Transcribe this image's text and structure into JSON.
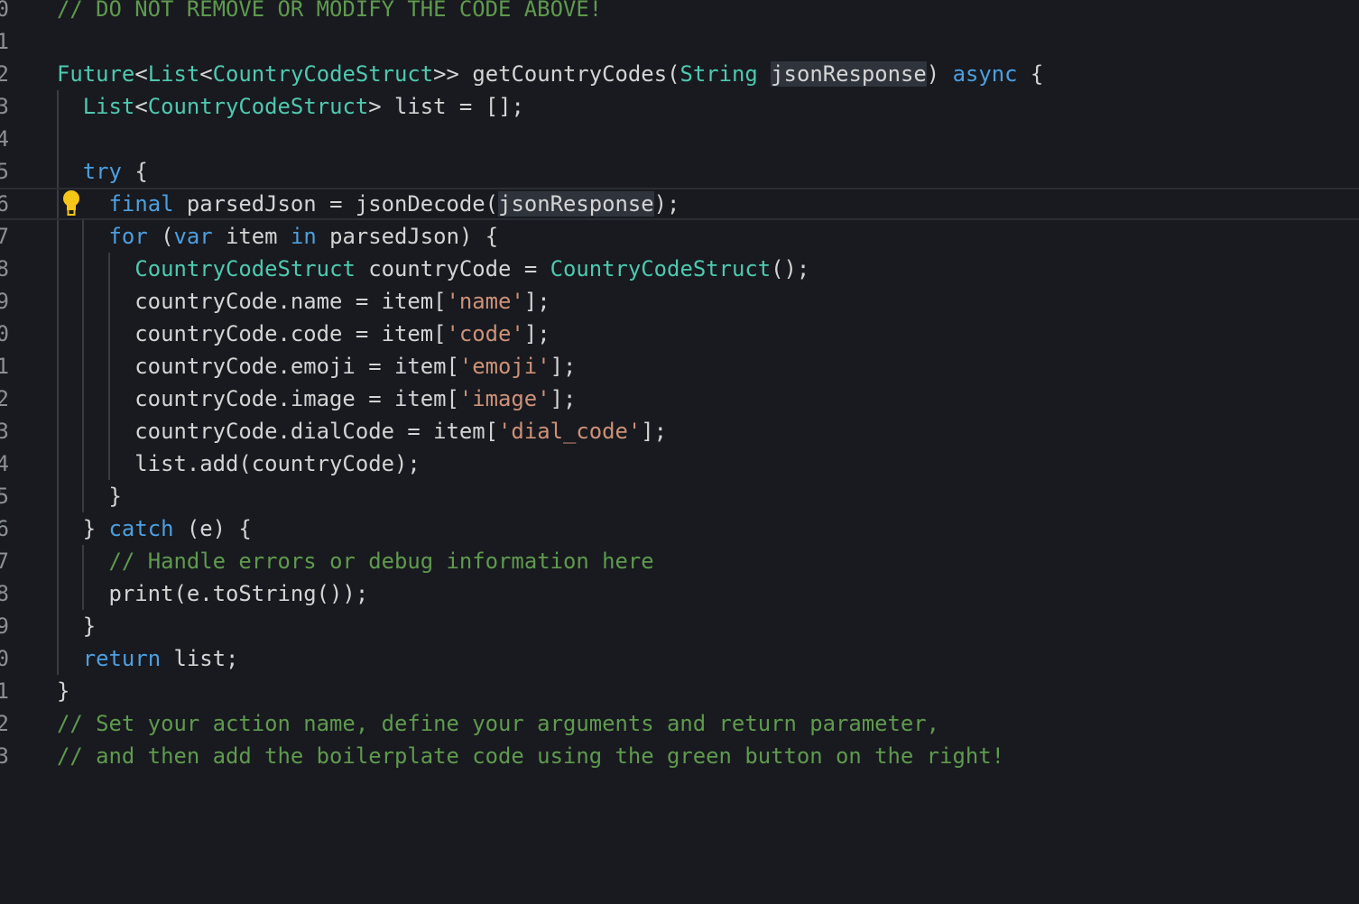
{
  "editor": {
    "current_line_index": 6,
    "colors": {
      "background": "#181a1f",
      "comment": "#5f9a4e",
      "type": "#4ec9b0",
      "keyword": "#4d9fe0",
      "string": "#ce9178",
      "text": "#d4d4d4"
    },
    "lightbulb_icon": "lightbulb-icon",
    "lines": [
      {
        "num": "0",
        "tokens": [
          {
            "t": "comment",
            "v": "// DO NOT REMOVE OR MODIFY THE CODE ABOVE!"
          }
        ]
      },
      {
        "num": "1",
        "tokens": []
      },
      {
        "num": "2",
        "tokens": [
          {
            "t": "type",
            "v": "Future"
          },
          {
            "t": "plain",
            "v": "<"
          },
          {
            "t": "type",
            "v": "List"
          },
          {
            "t": "plain",
            "v": "<"
          },
          {
            "t": "type",
            "v": "CountryCodeStruct"
          },
          {
            "t": "plain",
            "v": ">> getCountryCodes("
          },
          {
            "t": "type",
            "v": "String"
          },
          {
            "t": "plain",
            "v": " "
          },
          {
            "t": "highlight",
            "v": "jsonResponse"
          },
          {
            "t": "plain",
            "v": ") "
          },
          {
            "t": "keyword",
            "v": "async"
          },
          {
            "t": "plain",
            "v": " {"
          }
        ]
      },
      {
        "num": "3",
        "tokens": [
          {
            "t": "plain",
            "v": "  "
          },
          {
            "t": "type",
            "v": "List"
          },
          {
            "t": "plain",
            "v": "<"
          },
          {
            "t": "type",
            "v": "CountryCodeStruct"
          },
          {
            "t": "plain",
            "v": "> list = [];"
          }
        ]
      },
      {
        "num": "4",
        "tokens": []
      },
      {
        "num": "5",
        "tokens": [
          {
            "t": "plain",
            "v": "  "
          },
          {
            "t": "keyword",
            "v": "try"
          },
          {
            "t": "plain",
            "v": " {"
          }
        ]
      },
      {
        "num": "6",
        "tokens": [
          {
            "t": "plain",
            "v": "    "
          },
          {
            "t": "keyword",
            "v": "final"
          },
          {
            "t": "plain",
            "v": " parsedJson = jsonDecode("
          },
          {
            "t": "highlight",
            "v": "jsonResponse"
          },
          {
            "t": "plain",
            "v": ");"
          }
        ]
      },
      {
        "num": "7",
        "tokens": [
          {
            "t": "plain",
            "v": "    "
          },
          {
            "t": "keyword",
            "v": "for"
          },
          {
            "t": "plain",
            "v": " ("
          },
          {
            "t": "keyword",
            "v": "var"
          },
          {
            "t": "plain",
            "v": " item "
          },
          {
            "t": "keyword",
            "v": "in"
          },
          {
            "t": "plain",
            "v": " parsedJson) {"
          }
        ]
      },
      {
        "num": "8",
        "tokens": [
          {
            "t": "plain",
            "v": "      "
          },
          {
            "t": "type",
            "v": "CountryCodeStruct"
          },
          {
            "t": "plain",
            "v": " countryCode = "
          },
          {
            "t": "type",
            "v": "CountryCodeStruct"
          },
          {
            "t": "plain",
            "v": "();"
          }
        ]
      },
      {
        "num": "9",
        "tokens": [
          {
            "t": "plain",
            "v": "      countryCode.name = item["
          },
          {
            "t": "string",
            "v": "'name'"
          },
          {
            "t": "plain",
            "v": "];"
          }
        ]
      },
      {
        "num": "0",
        "tokens": [
          {
            "t": "plain",
            "v": "      countryCode.code = item["
          },
          {
            "t": "string",
            "v": "'code'"
          },
          {
            "t": "plain",
            "v": "];"
          }
        ]
      },
      {
        "num": "1",
        "tokens": [
          {
            "t": "plain",
            "v": "      countryCode.emoji = item["
          },
          {
            "t": "string",
            "v": "'emoji'"
          },
          {
            "t": "plain",
            "v": "];"
          }
        ]
      },
      {
        "num": "2",
        "tokens": [
          {
            "t": "plain",
            "v": "      countryCode.image = item["
          },
          {
            "t": "string",
            "v": "'image'"
          },
          {
            "t": "plain",
            "v": "];"
          }
        ]
      },
      {
        "num": "3",
        "tokens": [
          {
            "t": "plain",
            "v": "      countryCode.dialCode = item["
          },
          {
            "t": "string",
            "v": "'dial_code'"
          },
          {
            "t": "plain",
            "v": "];"
          }
        ]
      },
      {
        "num": "4",
        "tokens": [
          {
            "t": "plain",
            "v": "      list.add(countryCode);"
          }
        ]
      },
      {
        "num": "5",
        "tokens": [
          {
            "t": "plain",
            "v": "    }"
          }
        ]
      },
      {
        "num": "6",
        "tokens": [
          {
            "t": "plain",
            "v": "  } "
          },
          {
            "t": "keyword",
            "v": "catch"
          },
          {
            "t": "plain",
            "v": " (e) {"
          }
        ]
      },
      {
        "num": "7",
        "tokens": [
          {
            "t": "plain",
            "v": "    "
          },
          {
            "t": "comment",
            "v": "// Handle errors or debug information here"
          }
        ]
      },
      {
        "num": "8",
        "tokens": [
          {
            "t": "plain",
            "v": "    print(e.toString());"
          }
        ]
      },
      {
        "num": "9",
        "tokens": [
          {
            "t": "plain",
            "v": "  }"
          }
        ]
      },
      {
        "num": "0",
        "tokens": [
          {
            "t": "plain",
            "v": "  "
          },
          {
            "t": "keyword",
            "v": "return"
          },
          {
            "t": "plain",
            "v": " list;"
          }
        ]
      },
      {
        "num": "1",
        "tokens": [
          {
            "t": "plain",
            "v": "}"
          }
        ]
      },
      {
        "num": "2",
        "tokens": [
          {
            "t": "comment",
            "v": "// Set your action name, define your arguments and return parameter,"
          }
        ]
      },
      {
        "num": "3",
        "tokens": [
          {
            "t": "comment",
            "v": "// and then add the boilerplate code using the green button on the right!"
          }
        ]
      }
    ]
  }
}
